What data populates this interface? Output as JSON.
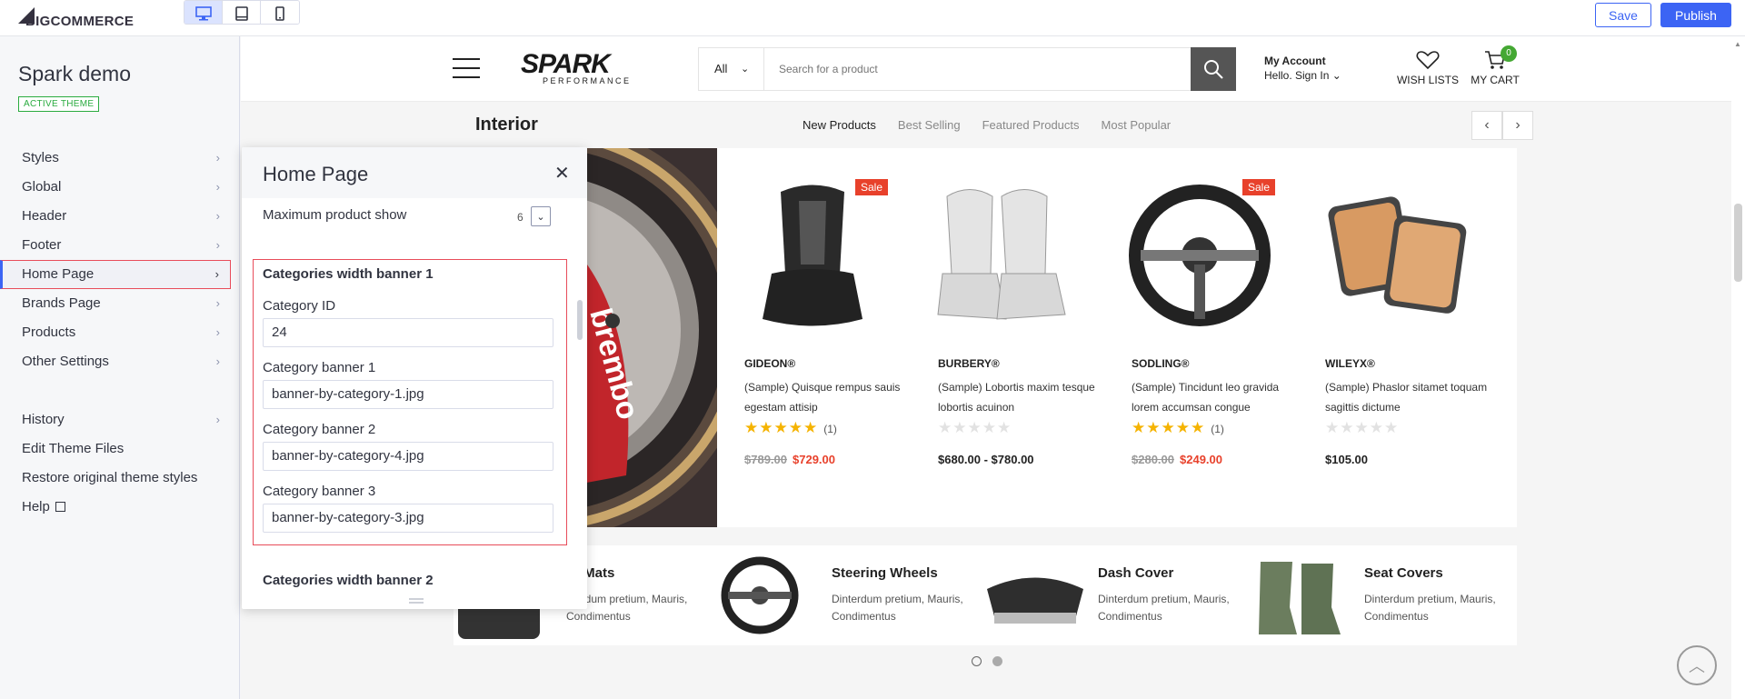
{
  "topbar": {
    "logo_text": "COMMERCE",
    "logo_prefix": "BIG",
    "devices": [
      "desktop-icon",
      "tablet-icon",
      "mobile-icon"
    ],
    "save_label": "Save",
    "publish_label": "Publish",
    "accent_color": "#3c64f4"
  },
  "sidebar": {
    "theme_name": "Spark demo",
    "badge": "ACTIVE THEME",
    "items": [
      {
        "label": "Styles"
      },
      {
        "label": "Global"
      },
      {
        "label": "Header"
      },
      {
        "label": "Footer"
      },
      {
        "label": "Home Page"
      },
      {
        "label": "Brands Page"
      },
      {
        "label": "Products"
      },
      {
        "label": "Other Settings"
      }
    ],
    "secondary": [
      {
        "label": "History"
      },
      {
        "label": "Edit Theme Files"
      },
      {
        "label": "Restore original theme styles"
      },
      {
        "label": "Help"
      }
    ]
  },
  "panel": {
    "title": "Home Page",
    "max_label": "Maximum product show",
    "max_value": "6",
    "group1_title": "Categories width banner 1",
    "fields": [
      {
        "label": "Category ID",
        "value": "24"
      },
      {
        "label": "Category banner 1",
        "value": "banner-by-category-1.jpg"
      },
      {
        "label": "Category banner 2",
        "value": "banner-by-category-4.jpg"
      },
      {
        "label": "Category banner 3",
        "value": "banner-by-category-3.jpg"
      }
    ],
    "group2_title": "Categories width banner 2"
  },
  "store": {
    "brand_main": "SPARK",
    "brand_sub": "PERFORMANCE",
    "search_category": "All",
    "search_placeholder": "Search for a product",
    "account_title": "My Account",
    "account_sub": "Hello. Sign In",
    "wishlist_label": "WISH LISTS",
    "cart_label": "MY CART",
    "cart_count": "0",
    "section_title": "Interior",
    "tabs": [
      "New Products",
      "Best Selling",
      "Featured Products",
      "Most Popular"
    ],
    "sale_label": "Sale",
    "products": [
      {
        "brand": "GIDEON®",
        "name": "(Sample) Quisque rempus sauis egestam attisip",
        "stars": 5,
        "count": "(1)",
        "old_price": "$789.00",
        "price": "$729.00",
        "sale": true
      },
      {
        "brand": "BURBERY®",
        "name": "(Sample) Lobortis maxim tesque lobortis acuinon",
        "stars": 0,
        "count": "",
        "old_price": "",
        "price": "$680.00 - $780.00",
        "sale": false
      },
      {
        "brand": "SODLING®",
        "name": "(Sample) Tincidunt leo gravida lorem accumsan congue",
        "stars": 5,
        "count": "(1)",
        "old_price": "$280.00",
        "price": "$249.00",
        "sale": true
      },
      {
        "brand": "WILEYX®",
        "name": "(Sample) Phaslor sitamet toquam sagittis dictume",
        "stars": 0,
        "count": "",
        "old_price": "",
        "price": "$105.00",
        "sale": false
      }
    ],
    "categories": [
      {
        "title": "or Mats",
        "desc": "nterdum pretium, Mauris, Condimentus"
      },
      {
        "title": "Steering Wheels",
        "desc": "Dinterdum pretium, Mauris, Condimentus"
      },
      {
        "title": "Dash Cover",
        "desc": "Dinterdum pretium, Mauris, Condimentus"
      },
      {
        "title": "Seat Covers",
        "desc": "Dinterdum pretium, Mauris, Condimentus"
      }
    ],
    "sale_color": "#e8412b",
    "star_color": "#f5b301"
  }
}
